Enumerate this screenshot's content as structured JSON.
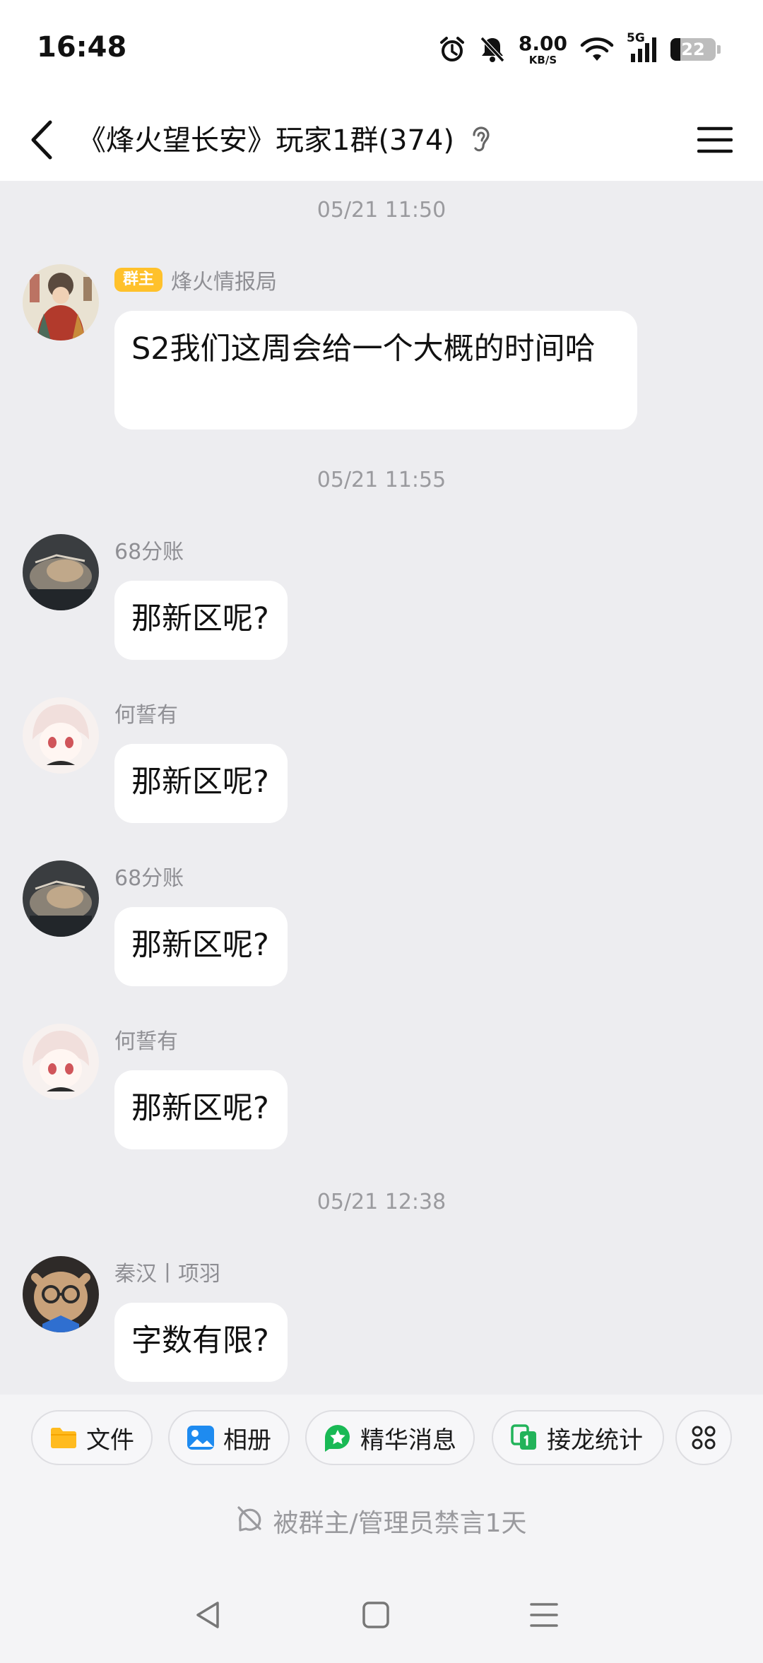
{
  "status_bar": {
    "time": "16:48",
    "net_speed_value": "8.00",
    "net_speed_unit": "KB/S",
    "network_type": "5G",
    "battery_level": "22"
  },
  "header": {
    "title": "《烽火望长安》玩家1群(374)"
  },
  "chat": {
    "timestamps": [
      "05/21 11:50",
      "05/21 11:55",
      "05/21 12:38"
    ],
    "messages": [
      {
        "sender": "烽火情报局",
        "role": "群主",
        "text": "S2我们这周会给一个大概的时间哈"
      },
      {
        "sender": "68分账",
        "text": "那新区呢?"
      },
      {
        "sender": "何誓有",
        "text": "那新区呢?"
      },
      {
        "sender": "68分账",
        "text": "那新区呢?"
      },
      {
        "sender": "何誓有",
        "text": "那新区呢?"
      },
      {
        "sender": "秦汉丨项羽",
        "text": "字数有限?"
      }
    ]
  },
  "toolbar": {
    "items": [
      {
        "label": "文件",
        "icon": "folder-icon"
      },
      {
        "label": "相册",
        "icon": "album-icon"
      },
      {
        "label": "精华消息",
        "icon": "star-icon"
      },
      {
        "label": "接龙统计",
        "icon": "relay-icon"
      }
    ]
  },
  "muted_notice": "被群主/管理员禁言1天",
  "colors": {
    "chat_background": "#ededf0",
    "bubble": "#ffffff",
    "role_badge": "#ffc12b",
    "folder": "#ffbb1f",
    "album": "#1e8bf0",
    "star_badge": "#19b955",
    "relay": "#22b35a"
  }
}
